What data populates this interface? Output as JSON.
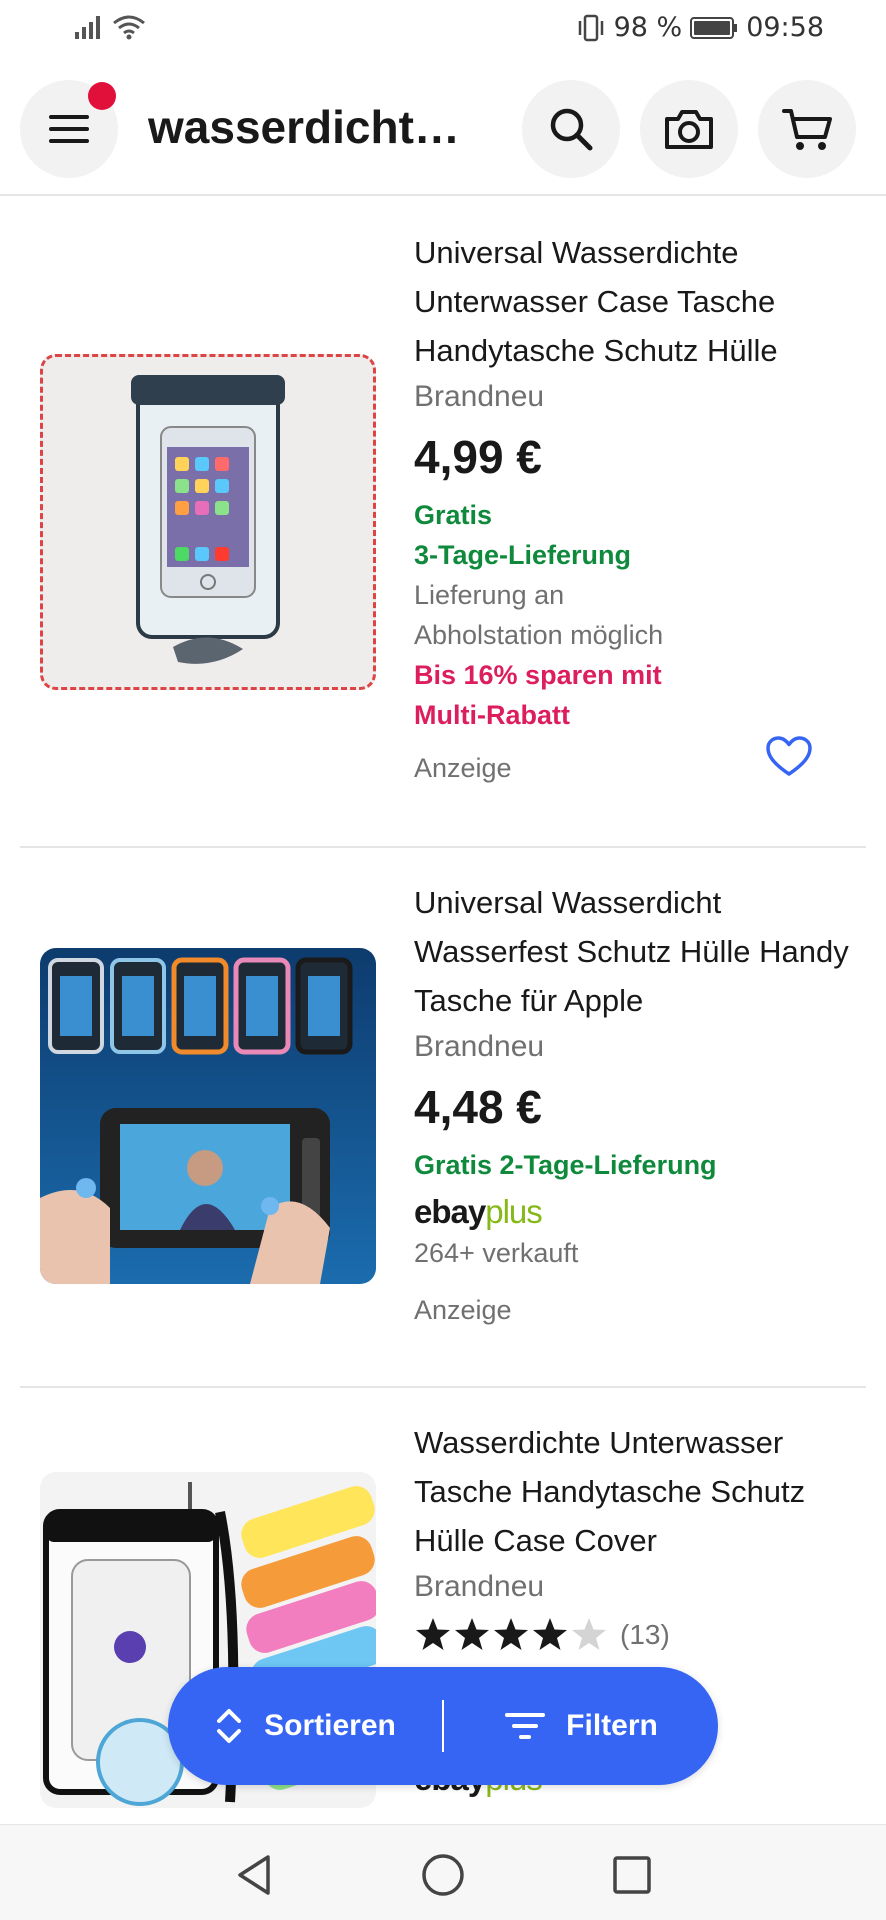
{
  "status_bar": {
    "battery_percent": "98 %",
    "time": "09:58"
  },
  "header": {
    "search_query": "wasserdicht…"
  },
  "items": [
    {
      "title": "Universal Wasserdichte Unterwasser Case Tasche Handytasche Schutz Hülle",
      "condition": "Brandneu",
      "price": "4,99 €",
      "shipping_line1": "Gratis",
      "shipping_line2": "3-Tage-Lieferung",
      "pickup_line1": "Lieferung an",
      "pickup_line2": "Abholstation möglich",
      "promo_line1": "Bis 16% sparen mit",
      "promo_line2": "Multi-Rabatt",
      "ad_label": "Anzeige"
    },
    {
      "title": "Universal Wasserdicht Wasserfest Schutz Hülle Handy Tasche für Apple",
      "condition": "Brandneu",
      "price": "4,48 €",
      "shipping": "Gratis 2-Tage-Lieferung",
      "ebay_word": "ebay",
      "plus_word": "plus",
      "sold": "264+ verkauft",
      "ad_label": "Anzeige"
    },
    {
      "title": "Wasserdichte Unterwasser Tasche Handytasche Schutz Hülle Case Cover",
      "condition": "Brandneu",
      "rating_count": "(13)",
      "rating_stars": 4.5,
      "ebay_word": "ebay",
      "plus_word": "plus"
    }
  ],
  "fab": {
    "sort_label": "Sortieren",
    "filter_label": "Filtern"
  },
  "colors": {
    "accent": "#3665f3",
    "green": "#0f8a3c",
    "promo_red": "#dd1e5d",
    "badge_red": "#e0103a"
  }
}
